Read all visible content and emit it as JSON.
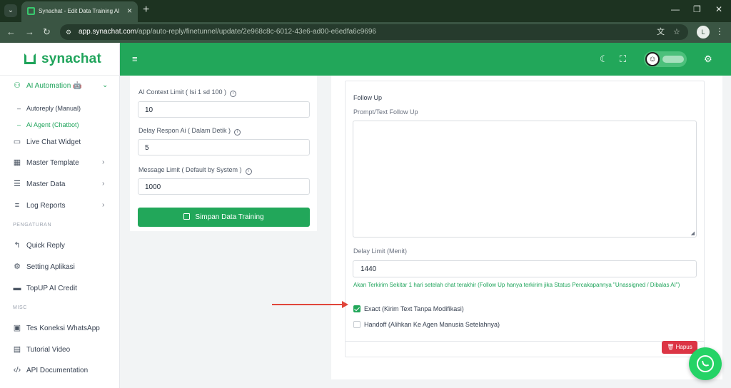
{
  "browser": {
    "tab_title": "Synachat - Edit Data Training AI",
    "url_domain": "app.synachat.com",
    "url_path": "/app/auto-reply/finetunnel/update/2e968c8c-6012-43e6-ad00-e6edfa6c9696",
    "profile_initial": "L"
  },
  "brand": {
    "name": "synachat",
    "color": "#1fa45b"
  },
  "sidebar": {
    "ai_automation": {
      "label": "AI Automation 🤖",
      "icon": "robot-icon"
    },
    "sub_items": [
      {
        "label": "Autoreply (Manual)"
      },
      {
        "label": "Ai Agent (Chatbot)"
      }
    ],
    "items": [
      {
        "label": "Live Chat Widget",
        "icon": "chat-widget-icon"
      },
      {
        "label": "Master Template",
        "icon": "template-icon"
      },
      {
        "label": "Master Data",
        "icon": "list-icon"
      },
      {
        "label": "Log Reports",
        "icon": "report-icon"
      }
    ],
    "section_settings": "PENGATURAN",
    "settings_items": [
      {
        "label": "Quick Reply",
        "icon": "reply-icon"
      },
      {
        "label": "Setting Aplikasi",
        "icon": "gear-icon"
      },
      {
        "label": "TopUP AI Credit",
        "icon": "card-icon"
      }
    ],
    "section_misc": "MISC",
    "misc_items": [
      {
        "label": "Tes Koneksi WhatsApp",
        "icon": "whatsapp-test-icon"
      },
      {
        "label": "Tutorial Video",
        "icon": "video-icon"
      },
      {
        "label": "API Documentation",
        "icon": "code-icon"
      }
    ]
  },
  "form_left": {
    "context_limit_label": "AI Context Limit ( Isi 1 sd 100 )",
    "context_limit_value": "10",
    "delay_label": "Delay Respon Ai ( Dalam Detik )",
    "delay_value": "5",
    "message_limit_label": "Message Limit ( Default by System )",
    "message_limit_value": "1000",
    "save_button": "Simpan Data Training"
  },
  "form_right": {
    "follow_up_title": "Follow Up",
    "prompt_label": "Prompt/Text Follow Up",
    "prompt_value": "",
    "delay_limit_label": "Delay Limit (Menit)",
    "delay_limit_value": "1440",
    "hint": "Akan Terkirim Sekitar 1 hari setelah chat terakhir (Follow Up hanya terkirim jika Status Percakapannya \"Unassigned / Dibalas AI\")",
    "exact_label": "Exact (Kirim Text Tanpa Modifikasi)",
    "exact_checked": true,
    "handoff_label": "Handoff (Alihkan Ke Agen Manusia Setelahnya)",
    "handoff_checked": false,
    "delete_button": "Hapus"
  },
  "colors": {
    "primary": "#22a75a",
    "danger": "#dc3545",
    "annotation_arrow": "#e0453a"
  }
}
